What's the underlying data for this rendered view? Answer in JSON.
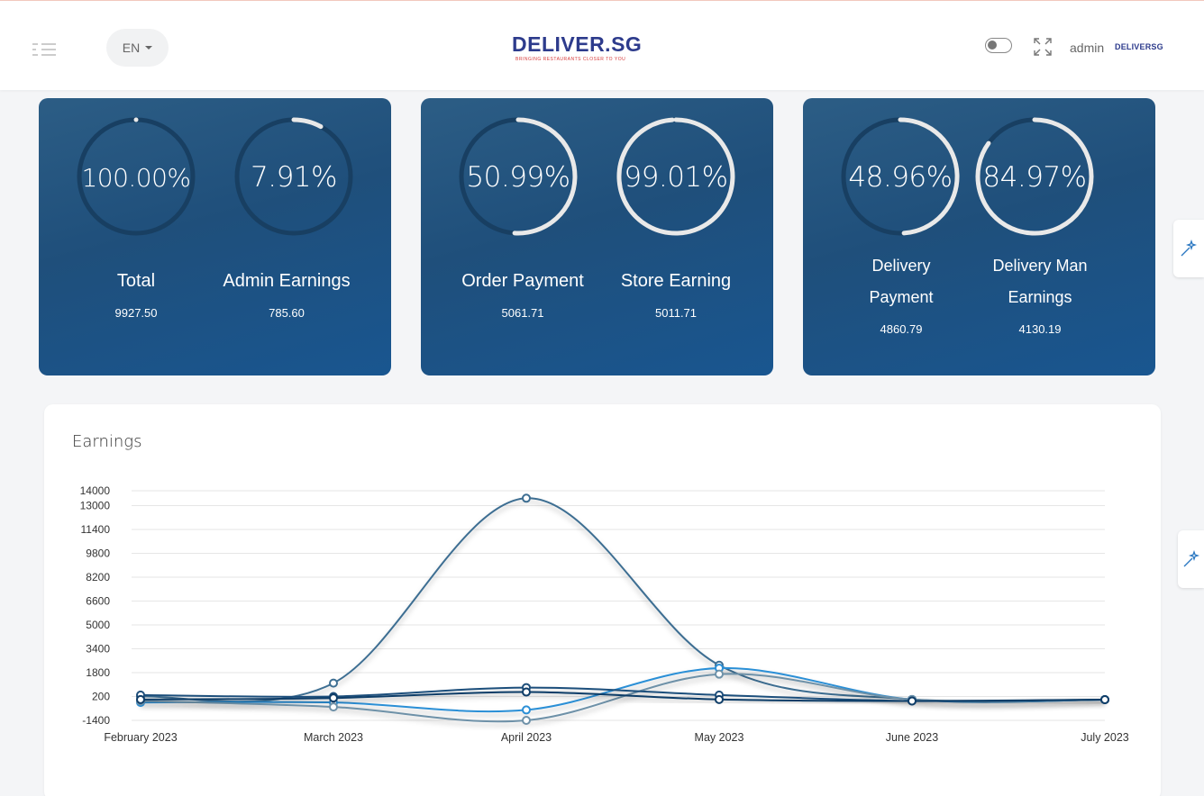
{
  "header": {
    "language": "EN",
    "logo_text": "DELIVER.SG",
    "logo_tagline": "BRINGING RESTAURANTS CLOSER TO YOU",
    "user_name": "admin",
    "avatar_text": "DELIVERSG"
  },
  "stat_cards": [
    {
      "items": [
        {
          "percent": "100.00%",
          "progress": 100,
          "label": "Total",
          "amount": "9927.50"
        },
        {
          "percent": "7.91%",
          "progress": 7.91,
          "label": "Admin Earnings",
          "amount": "785.60"
        }
      ]
    },
    {
      "items": [
        {
          "percent": "50.99%",
          "progress": 50.99,
          "label": "Order Payment",
          "amount": "5061.71"
        },
        {
          "percent": "99.01%",
          "progress": 99.01,
          "label": "Store Earning",
          "amount": "5011.71"
        }
      ]
    },
    {
      "items": [
        {
          "percent": "48.96%",
          "progress": 48.96,
          "label_line1": "Delivery",
          "label_line2": "Payment",
          "amount": "4860.79"
        },
        {
          "percent": "84.97%",
          "progress": 84.97,
          "label_line1": "Delivery Man",
          "label_line2": "Earnings",
          "amount": "4130.19"
        }
      ]
    }
  ],
  "colors": {
    "card_bg": "#1f4f7b",
    "gauge_track": "#183f62",
    "gauge_fill": "#e9e9e9",
    "series": [
      "#3d6e92",
      "#2b8fd6",
      "#6e91a8",
      "#1f4f7b",
      "#0f3d68"
    ]
  },
  "chart_data": {
    "type": "line",
    "title": "Earnings",
    "categories": [
      "February 2023",
      "March 2023",
      "April 2023",
      "May 2023",
      "June 2023",
      "July 2023"
    ],
    "y_ticks": [
      14000,
      13000,
      11400,
      9800,
      8200,
      6600,
      5000,
      3400,
      1800,
      200,
      -1400
    ],
    "ylim": [
      -1400,
      14000
    ],
    "grid": true,
    "legend": "none",
    "series": [
      {
        "values": [
          200,
          1100,
          13500,
          2300,
          0,
          -10
        ]
      },
      {
        "values": [
          -200,
          -200,
          -700,
          2100,
          0,
          -10
        ]
      },
      {
        "values": [
          -100,
          -500,
          -1400,
          1700,
          0,
          -10
        ]
      },
      {
        "values": [
          300,
          200,
          800,
          300,
          -100,
          -10
        ]
      },
      {
        "values": [
          0,
          100,
          500,
          0,
          -100,
          -10
        ]
      }
    ]
  }
}
